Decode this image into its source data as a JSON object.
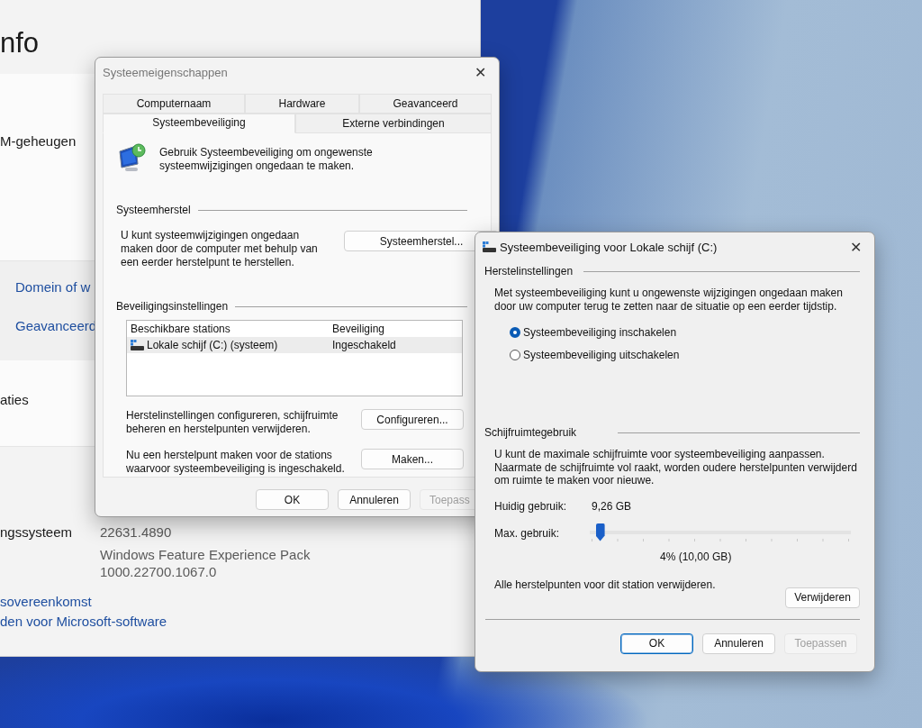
{
  "settings_window": {
    "title": "nfo",
    "memory_label": "M-geheugen",
    "related_links": [
      "Domein of w",
      "Geavanceerd"
    ],
    "section_label": "aties",
    "os_rows": [
      {
        "label": "ngssysteem",
        "values": [
          "22631.4890"
        ]
      },
      {
        "label": "",
        "values": [
          "Windows Feature Experience Pack",
          "1000.22700.1067.0"
        ]
      }
    ],
    "legal_links": [
      "sovereenkomst",
      "den voor Microsoft-software"
    ]
  },
  "properties_dialog": {
    "title": "Systeemeigenschappen",
    "close": "✕",
    "tab_rows": [
      [
        {
          "label": "Computernaam",
          "selected": false
        },
        {
          "label": "Hardware",
          "selected": false
        },
        {
          "label": "Geavanceerd",
          "selected": false
        }
      ],
      [
        {
          "label": "Systeembeveiliging",
          "selected": true
        },
        {
          "label": "Externe verbindingen",
          "selected": false
        }
      ]
    ],
    "intro": "Gebruik Systeembeveiliging om ongewenste systeemwijzigingen ongedaan te maken.",
    "restore_group": {
      "title": "Systeemherstel",
      "text": "U kunt systeemwijzigingen ongedaan maken door de computer met behulp van een eerder herstelpunt te herstellen.",
      "button": "Systeemherstel..."
    },
    "protection_group": {
      "title": "Beveiligingsinstellingen",
      "columns": [
        "Beschikbare stations",
        "Beveiliging"
      ],
      "rows": [
        {
          "cells": [
            "Lokale schijf (C:) (systeem)",
            "Ingeschakeld"
          ],
          "selected": true
        }
      ],
      "actions": [
        {
          "text": "Herstelinstellingen configureren, schijfruimte beheren en herstelpunten verwijderen.",
          "button": "Configureren..."
        },
        {
          "text": "Nu een herstelpunt maken voor de stations waarvoor systeembeveiliging is ingeschakeld.",
          "button": "Maken..."
        }
      ]
    },
    "buttons": [
      {
        "label": "OK",
        "default": false,
        "disabled": false
      },
      {
        "label": "Annuleren",
        "default": false,
        "disabled": false
      },
      {
        "label": "Toepass",
        "default": false,
        "disabled": true
      }
    ]
  },
  "drive_dialog": {
    "title": "Systeembeveiliging voor Lokale schijf (C:)",
    "close": "✕",
    "restore_settings": {
      "title": "Herstelinstellingen",
      "text": "Met systeembeveiliging kunt u ongewenste wijzigingen ongedaan maken door uw computer terug te zetten naar de situatie op een eerder tijdstip.",
      "options": [
        {
          "label": "Systeembeveiliging inschakelen",
          "selected": true
        },
        {
          "label": "Systeembeveiliging uitschakelen",
          "selected": false
        }
      ]
    },
    "disk_usage": {
      "title": "Schijfruimtegebruik",
      "text": "U kunt de maximale schijfruimte voor systeembeveiliging aanpassen. Naarmate de schijfruimte vol raakt, worden oudere herstelpunten verwijderd om ruimte te maken voor nieuwe.",
      "current_label": "Huidig gebruik:",
      "current_value": "9,26 GB",
      "max_label": "Max. gebruik:",
      "max_slider": {
        "level": 0.04
      },
      "max_reading": "4% (10,00 GB)",
      "delete_text": "Alle herstelpunten voor dit station verwijderen.",
      "delete_button": "Verwijderen"
    },
    "buttons": [
      {
        "label": "OK",
        "default": true,
        "disabled": false
      },
      {
        "label": "Annuleren",
        "default": false,
        "disabled": false
      },
      {
        "label": "Toepassen",
        "default": false,
        "disabled": true
      }
    ]
  }
}
